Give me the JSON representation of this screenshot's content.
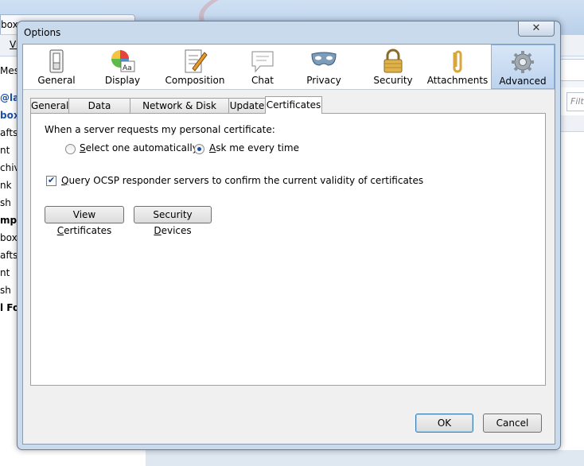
{
  "background": {
    "tab_label": "box",
    "menu_label": "Vi",
    "left_items": [
      {
        "text": "Mess",
        "style": "normal"
      },
      {
        "text": "@lal",
        "style": "blue"
      },
      {
        "text": "box (",
        "style": "blue"
      },
      {
        "text": "afts",
        "style": "normal"
      },
      {
        "text": "nt",
        "style": "normal"
      },
      {
        "text": "chive",
        "style": "normal"
      },
      {
        "text": "nk",
        "style": "normal"
      },
      {
        "text": "sh",
        "style": "normal"
      },
      {
        "text": "mpar",
        "style": "bold"
      },
      {
        "text": "box",
        "style": "normal"
      },
      {
        "text": "afts",
        "style": "normal"
      },
      {
        "text": "nt",
        "style": "normal"
      },
      {
        "text": "sh",
        "style": "normal"
      },
      {
        "text": "l Fo",
        "style": "bold"
      }
    ],
    "filter_placeholder": "Filt"
  },
  "dialog": {
    "title": "Options",
    "close_glyph": "✕"
  },
  "panes": [
    {
      "label": "General",
      "icon": "switch-icon",
      "selected": false
    },
    {
      "label": "Display",
      "icon": "color-wheel-icon",
      "selected": false
    },
    {
      "label": "Composition",
      "icon": "document-pen-icon",
      "selected": false
    },
    {
      "label": "Chat",
      "icon": "speech-bubble-icon",
      "selected": false
    },
    {
      "label": "Privacy",
      "icon": "mask-icon",
      "selected": false
    },
    {
      "label": "Security",
      "icon": "padlock-icon",
      "selected": false
    },
    {
      "label": "Attachments",
      "icon": "paperclip-icon",
      "selected": false
    },
    {
      "label": "Advanced",
      "icon": "gear-icon",
      "selected": true
    }
  ],
  "tabs": [
    {
      "label": "General",
      "active": false
    },
    {
      "label": "Data Choices",
      "active": false
    },
    {
      "label": "Network & Disk Space",
      "active": false
    },
    {
      "label": "Update",
      "active": false
    },
    {
      "label": "Certificates",
      "active": true
    }
  ],
  "certificates": {
    "prompt": "When a server requests my personal certificate:",
    "option_auto": {
      "prefix": "",
      "accesskey": "S",
      "rest": "elect one automatically",
      "checked": false
    },
    "option_ask": {
      "prefix": "",
      "accesskey": "A",
      "rest": "sk me every time",
      "checked": true
    },
    "ocsp": {
      "accesskey": "Q",
      "rest": "uery OCSP responder servers to confirm the current validity of certificates",
      "checked": true
    },
    "view_button": {
      "prefix": "View ",
      "accesskey": "C",
      "rest": "ertificates"
    },
    "devices_button": {
      "prefix": "Security ",
      "accesskey": "D",
      "rest": "evices"
    }
  },
  "footer": {
    "ok": "OK",
    "cancel": "Cancel"
  }
}
